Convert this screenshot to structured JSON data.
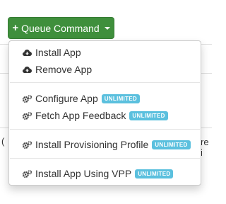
{
  "queue_button": {
    "label": "Queue Command",
    "plus_icon": "plus-icon",
    "caret_icon": "caret-down-icon"
  },
  "background": {
    "peek_left": "(",
    "peek_right": "re i"
  },
  "menu": {
    "items": [
      {
        "label": "Install App",
        "icon": "cloud-download-icon"
      },
      {
        "label": "Remove App",
        "icon": "cloud-upload-icon"
      },
      {
        "label": "Configure App",
        "icon": "cogs-icon",
        "badge": "UNLIMITED"
      },
      {
        "label": "Fetch App Feedback",
        "icon": "cogs-icon",
        "badge": "UNLIMITED"
      },
      {
        "label": "Install Provisioning Profile",
        "icon": "cogs-icon",
        "badge": "UNLIMITED"
      },
      {
        "label": "Install App Using VPP",
        "icon": "cogs-icon",
        "badge": "UNLIMITED"
      }
    ]
  },
  "colors": {
    "primary_green": "#3f8f3c",
    "badge_info": "#5bc0de"
  }
}
